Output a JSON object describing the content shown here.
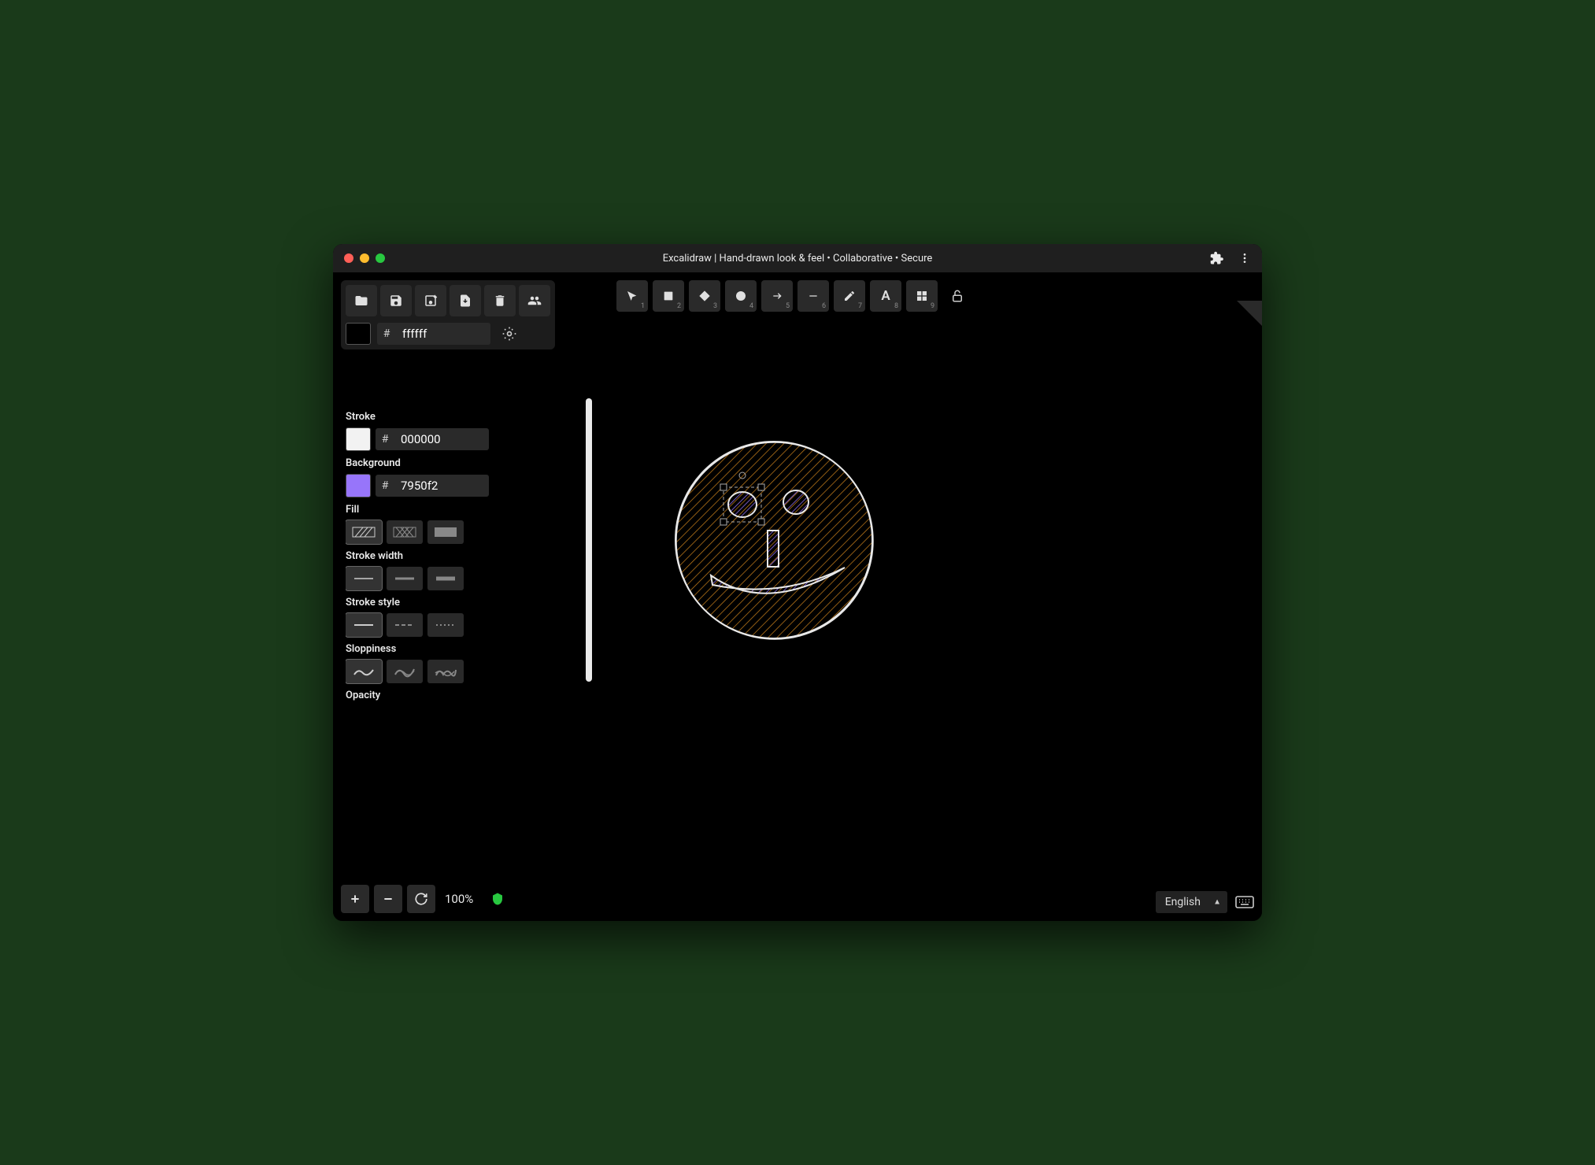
{
  "window": {
    "title": "Excalidraw | Hand-drawn look & feel • Collaborative • Secure"
  },
  "canvas_color": {
    "hash": "#",
    "hex": "ffffff"
  },
  "tools": [
    {
      "name": "select",
      "key": "1"
    },
    {
      "name": "rectangle",
      "key": "2"
    },
    {
      "name": "diamond",
      "key": "3"
    },
    {
      "name": "ellipse",
      "key": "4"
    },
    {
      "name": "arrow",
      "key": "5"
    },
    {
      "name": "line",
      "key": "6"
    },
    {
      "name": "draw",
      "key": "7"
    },
    {
      "name": "text",
      "key": "8"
    },
    {
      "name": "image",
      "key": "9"
    }
  ],
  "props": {
    "stroke": {
      "label": "Stroke",
      "hash": "#",
      "hex": "000000",
      "swatch": "#f2f2f2"
    },
    "background": {
      "label": "Background",
      "hash": "#",
      "hex": "7950f2",
      "swatch": "#9775fa"
    },
    "fill": {
      "label": "Fill",
      "options": [
        "hachure",
        "cross-hatch",
        "solid"
      ],
      "active": 0
    },
    "stroke_width": {
      "label": "Stroke width",
      "options": [
        "thin",
        "medium",
        "thick"
      ],
      "active": 0
    },
    "stroke_style": {
      "label": "Stroke style",
      "options": [
        "solid",
        "dashed",
        "dotted"
      ],
      "active": 0
    },
    "sloppiness": {
      "label": "Sloppiness",
      "options": [
        "architect",
        "artist",
        "cartoonist"
      ],
      "active": 0
    },
    "opacity": {
      "label": "Opacity"
    }
  },
  "footer": {
    "zoom": "100%",
    "language": "English"
  }
}
